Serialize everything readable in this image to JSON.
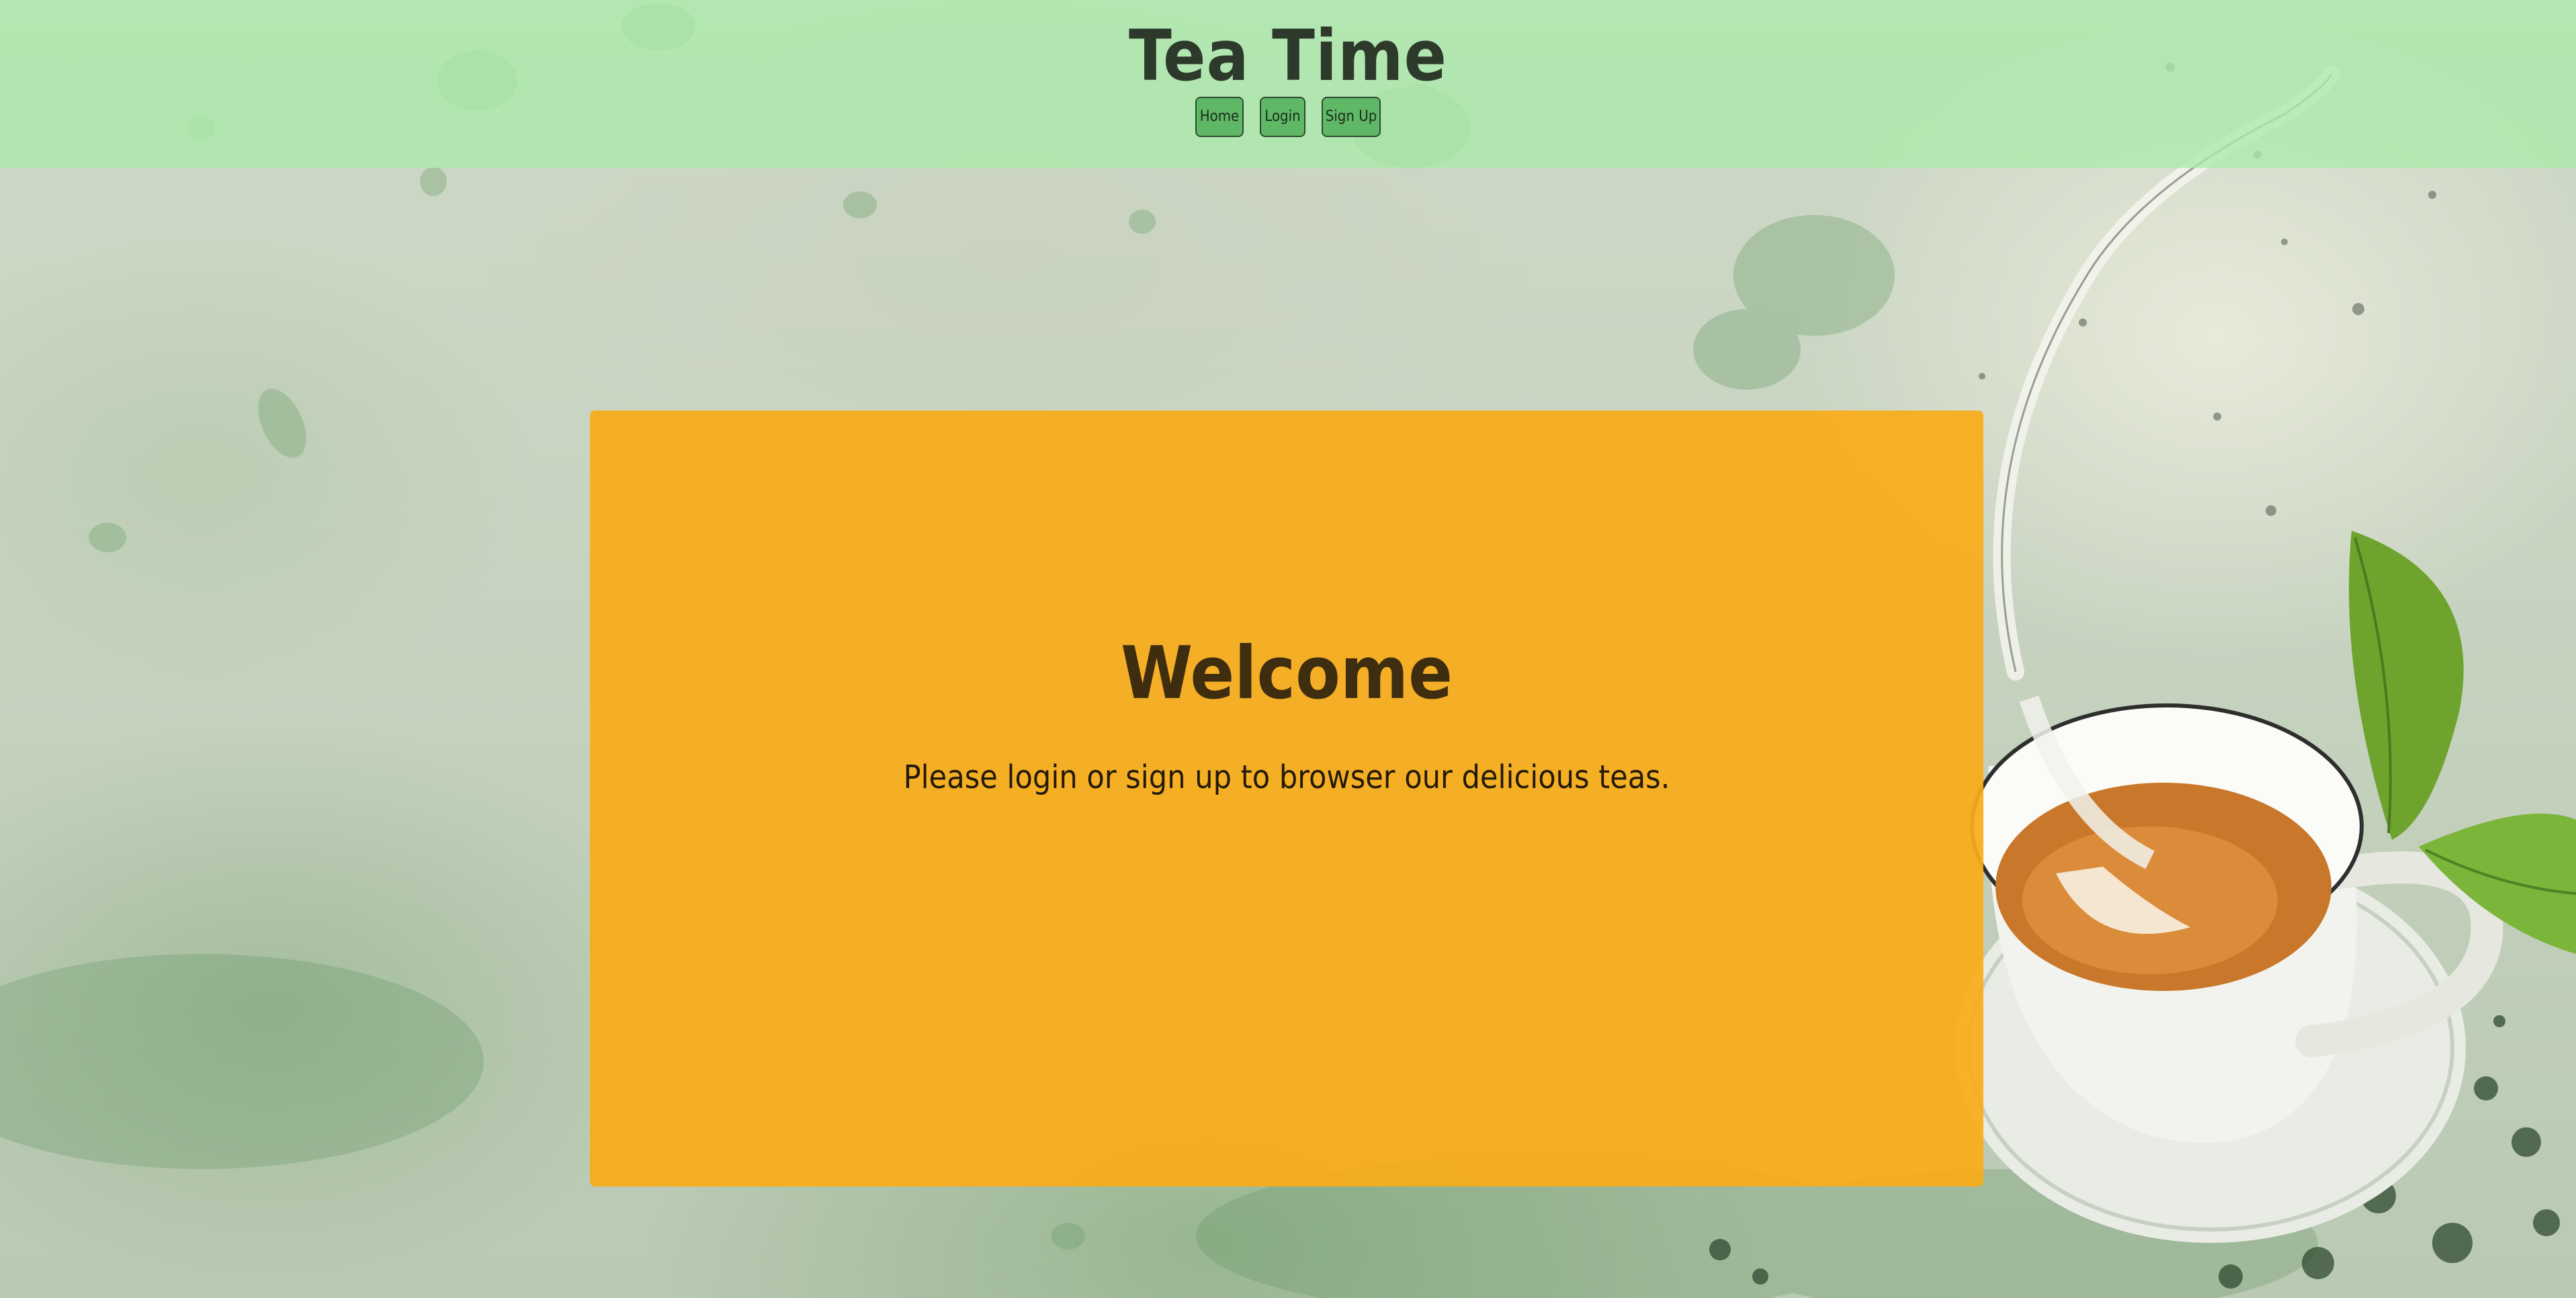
{
  "header": {
    "title": "Tea Time",
    "nav": {
      "home": "Home",
      "login": "Login",
      "signup": "Sign Up"
    }
  },
  "main": {
    "heading": "Welcome",
    "message": "Please login or sign up to browser our delicious teas."
  },
  "colors": {
    "header_background": "#aaebaa",
    "nav_button": "#5fb865",
    "panel_background": "#f9ac1a",
    "title_text": "#2d3a2b",
    "panel_heading_text": "#3f2d10"
  },
  "images": {
    "background": "watercolor-green-tea-cup-illustration"
  }
}
